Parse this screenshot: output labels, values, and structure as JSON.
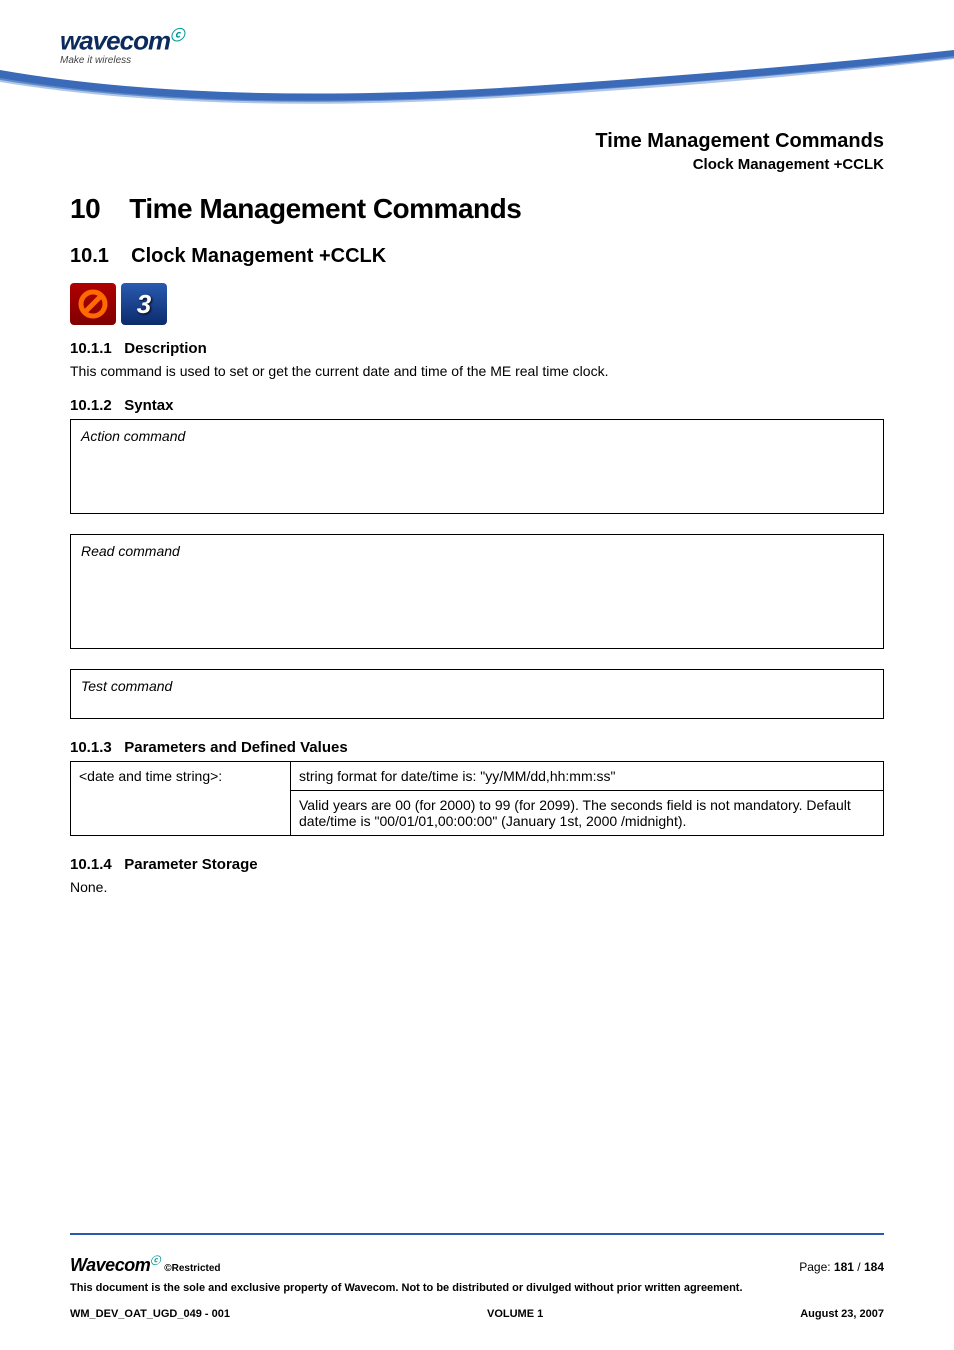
{
  "logo": {
    "brand": "wavecom",
    "tagline": "Make it wireless"
  },
  "pageHeader": {
    "title": "Time Management Commands",
    "subtitle": "Clock Management +CCLK"
  },
  "chapter": {
    "number": "10",
    "title": "Time Management Commands"
  },
  "section": {
    "number": "10.1",
    "title": "Clock Management +CCLK"
  },
  "icons": {
    "red_glyph": "🚫",
    "blue_glyph": "3"
  },
  "sub1": {
    "number": "10.1.1",
    "title": "Description",
    "text": "This command is used to set or get the current date and time of the ME real time clock."
  },
  "sub2": {
    "number": "10.1.2",
    "title": "Syntax",
    "box1": "Action command",
    "box2": "Read command",
    "box3": "Test command"
  },
  "sub3": {
    "number": "10.1.3",
    "title": "Parameters and Defined Values",
    "row1_key": "<date and time string>:",
    "row1_val": "string format for date/time is: \"yy/MM/dd,hh:mm:ss\"",
    "row2_val": "Valid years are 00 (for 2000) to 99 (for 2099). The seconds field is not mandatory. Default date/time is \"00/01/01,00:00:00\" (January 1st, 2000 /midnight)."
  },
  "sub4": {
    "number": "10.1.4",
    "title": "Parameter Storage",
    "text": "None."
  },
  "footer": {
    "brand": "Wavecom",
    "restricted": "©Restricted",
    "page_label": "Page: ",
    "page_current": "181",
    "page_sep": " / ",
    "page_total": "184",
    "disclaimer": "This document is the sole and exclusive property of Wavecom. Not to be distributed or divulged without prior written agreement.",
    "doc_id": "WM_DEV_OAT_UGD_049 - 001",
    "volume": "VOLUME 1",
    "date": "August 23, 2007"
  }
}
